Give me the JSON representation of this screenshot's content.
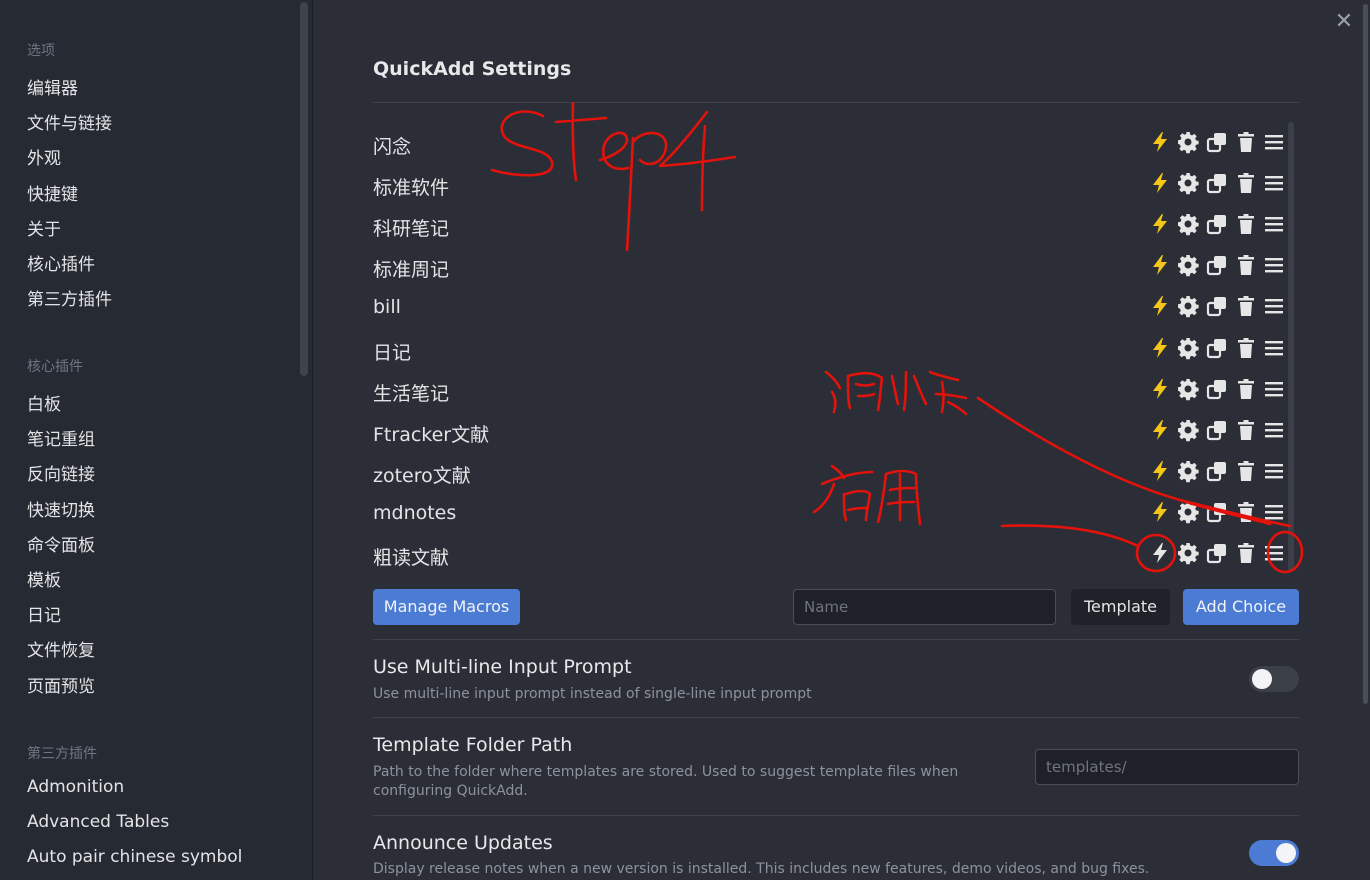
{
  "sidebar": {
    "sections": [
      {
        "heading": "选项",
        "items": [
          "编辑器",
          "文件与链接",
          "外观",
          "快捷键",
          "关于",
          "核心插件",
          "第三方插件"
        ]
      },
      {
        "heading": "核心插件",
        "items": [
          "白板",
          "笔记重组",
          "反向链接",
          "快速切换",
          "命令面板",
          "模板",
          "日记",
          "文件恢复",
          "页面预览"
        ]
      },
      {
        "heading": "第三方插件",
        "items": [
          "Admonition",
          "Advanced Tables",
          "Auto pair chinese symbol"
        ]
      }
    ]
  },
  "main": {
    "title": "QuickAdd Settings",
    "choices": [
      "闪念",
      "标准软件",
      "科研笔记",
      "标准周记",
      "bill",
      "日记",
      "生活笔记",
      "Ftracker文献",
      "zotero文献",
      "mdnotes",
      "粗读文献"
    ],
    "choice_icons": [
      "lightning-icon",
      "gear-icon",
      "copy-icon",
      "trash-icon",
      "drag-handle-icon"
    ],
    "buttons": {
      "manage_macros": "Manage Macros",
      "template": "Template",
      "add_choice": "Add Choice"
    },
    "name_input": {
      "placeholder": "Name",
      "value": ""
    },
    "settings": {
      "multiline": {
        "name": "Use Multi-line Input Prompt",
        "desc": "Use multi-line input prompt instead of single-line input prompt",
        "enabled": false
      },
      "template_folder": {
        "name": "Template Folder Path",
        "desc": "Path to the folder where templates are stored. Used to suggest template files when configuring QuickAdd.",
        "placeholder": "templates/"
      },
      "announce": {
        "name": "Announce Updates",
        "desc": "Display release notes when a new version is installed. This includes new features, demo videos, and bug fixes.",
        "enabled": true
      }
    }
  },
  "colors": {
    "accent": "#4c7bd3",
    "lightning_active": "#f5c518",
    "lightning_inactive": "#e6e6e6",
    "annotation": "#e3120b"
  }
}
